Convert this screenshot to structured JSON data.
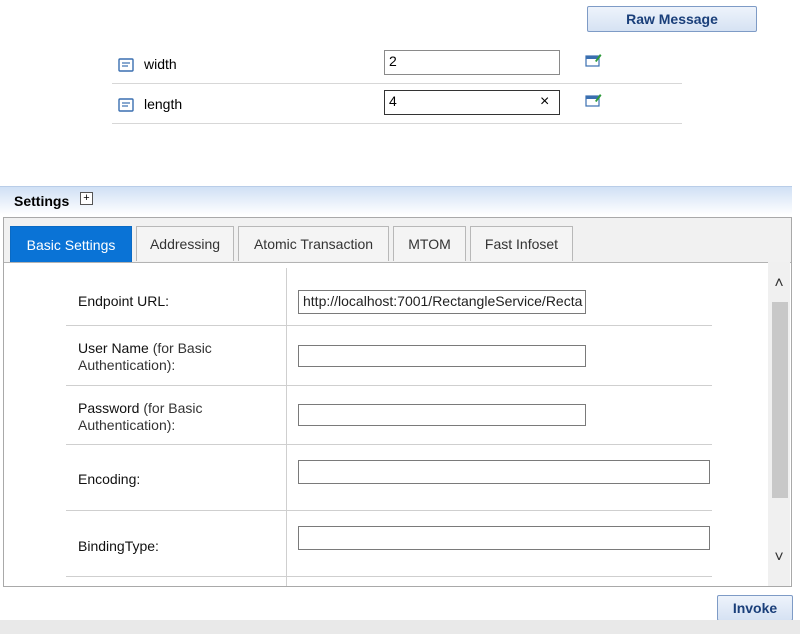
{
  "toolbar": {
    "raw_message_label": "Raw Message"
  },
  "params": [
    {
      "name": "width",
      "value": "2"
    },
    {
      "name": "length",
      "value": "4",
      "clear": "×"
    }
  ],
  "settings": {
    "title": "Settings",
    "expand_symbol": "+",
    "tabs": [
      "Basic Settings",
      "Addressing",
      "Atomic Transaction",
      "MTOM",
      "Fast Infoset"
    ],
    "active_tab": "Basic Settings",
    "fields": {
      "endpoint_label": "Endpoint URL:",
      "endpoint_value": "http://localhost:7001/RectangleService/Recta",
      "username_label": "User Name",
      "username_sub": "(for Basic",
      "username_sub2": "Authentication):",
      "password_label": "Password",
      "password_sub": "(for Basic",
      "password_sub2": "Authentication):",
      "encoding_label": "Encoding:",
      "bindingtype_label": "BindingType:"
    },
    "scroll": {
      "up": "˄",
      "down": "˅"
    }
  },
  "footer": {
    "invoke_label": "Invoke"
  },
  "icons": {
    "param_icon": "param-doc-icon",
    "edit_icon": "edit-param-icon"
  },
  "colors": {
    "accent": "#0a73d6",
    "button_text": "#1a3f7a"
  }
}
